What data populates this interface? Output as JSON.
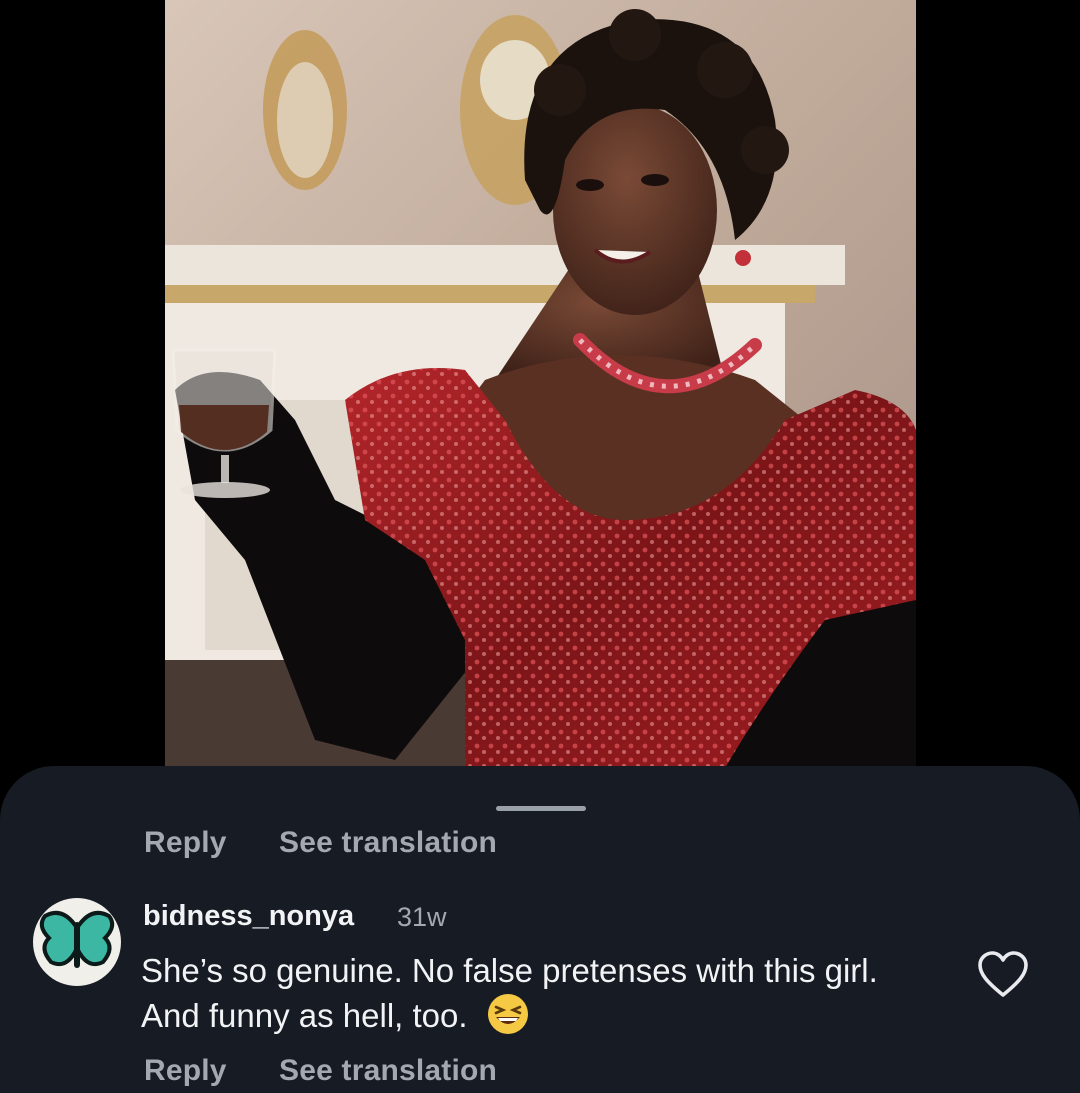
{
  "photo": {
    "subject": "woman in red sequined gown raising a glass",
    "colors": {
      "dress": "#8e1a1c",
      "glove": "#0d0b0c",
      "wall": "#c9b6a8"
    }
  },
  "top_comment_actions": {
    "reply_label": "Reply",
    "translate_label": "See translation"
  },
  "comment": {
    "avatar_icon": "butterfly-icon",
    "username": "bidness_nonya",
    "time": "31w",
    "text": "She’s so genuine. No false pretenses with this girl.  And funny as hell, too.",
    "emoji_icon": "grinning-squinting-face-icon",
    "like_icon": "heart-icon",
    "reply_label": "Reply",
    "translate_label": "See translation"
  },
  "colors": {
    "sheet_bg": "#161b24",
    "primary_text": "#f2f3f5",
    "secondary_text": "#a4a9b1"
  }
}
